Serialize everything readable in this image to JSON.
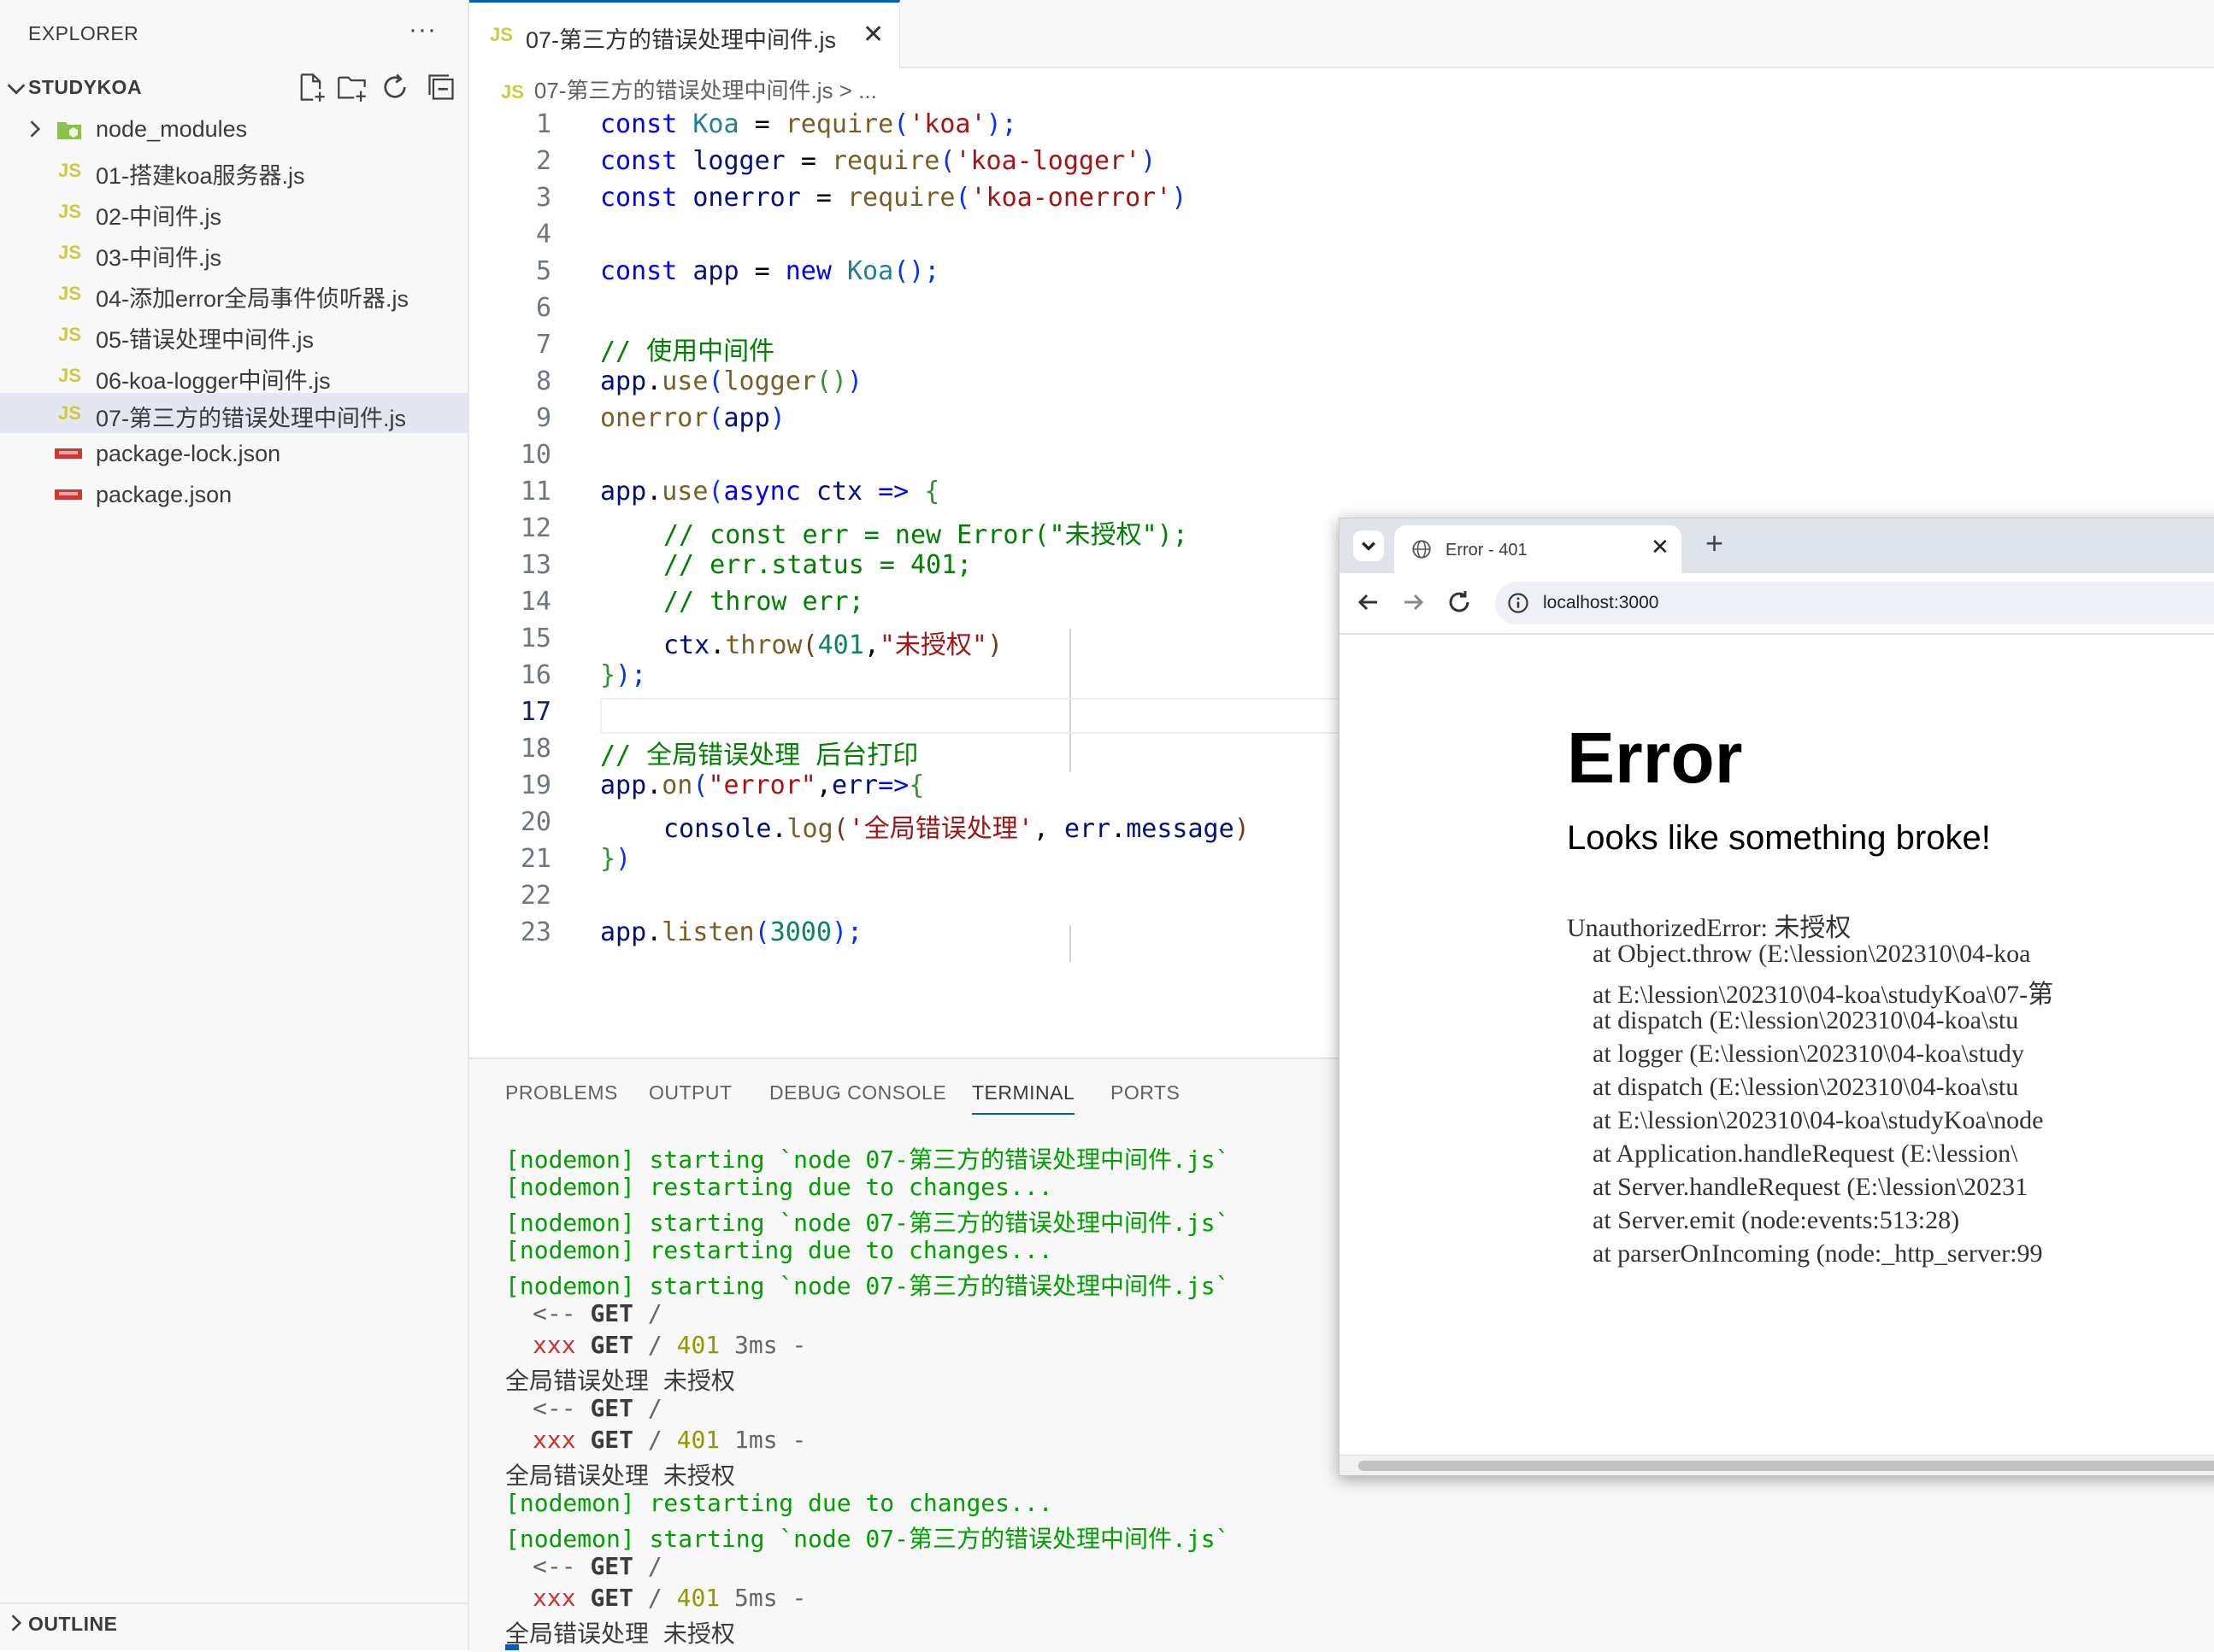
{
  "sidebar": {
    "header": "EXPLORER",
    "more": "···",
    "project": "STUDYKOA",
    "items": [
      {
        "label": "node_modules",
        "icon": "folder"
      },
      {
        "label": "01-搭建koa服务器.js",
        "icon": "js"
      },
      {
        "label": "02-中间件.js",
        "icon": "js"
      },
      {
        "label": "03-中间件.js",
        "icon": "js"
      },
      {
        "label": "04-添加error全局事件侦听器.js",
        "icon": "js"
      },
      {
        "label": "05-错误处理中间件.js",
        "icon": "js"
      },
      {
        "label": "06-koa-logger中间件.js",
        "icon": "js"
      },
      {
        "label": "07-第三方的错误处理中间件.js",
        "icon": "js",
        "active": true
      },
      {
        "label": "package-lock.json",
        "icon": "npm"
      },
      {
        "label": "package.json",
        "icon": "npm"
      }
    ],
    "outline": "OUTLINE"
  },
  "js_badge": "JS",
  "editor": {
    "tab_title": "07-第三方的错误处理中间件.js",
    "tab_close": "✕",
    "breadcrumb": "07-第三方的错误处理中间件.js > ...",
    "current_line": 17
  },
  "code_lines": [
    {
      "n": "1"
    },
    {
      "n": "2"
    },
    {
      "n": "3"
    },
    {
      "n": "4"
    },
    {
      "n": "5"
    },
    {
      "n": "6"
    },
    {
      "n": "7"
    },
    {
      "n": "8"
    },
    {
      "n": "9"
    },
    {
      "n": "10"
    },
    {
      "n": "11"
    },
    {
      "n": "12"
    },
    {
      "n": "13"
    },
    {
      "n": "14"
    },
    {
      "n": "15"
    },
    {
      "n": "16"
    },
    {
      "n": "17"
    },
    {
      "n": "18"
    },
    {
      "n": "19"
    },
    {
      "n": "20"
    },
    {
      "n": "21"
    },
    {
      "n": "22"
    },
    {
      "n": "23"
    }
  ],
  "code": {
    "l1": [
      "const",
      "Koa",
      "=",
      "require",
      "(",
      "'koa'",
      ");"
    ],
    "l2": [
      "const",
      "logger",
      "=",
      "require",
      "(",
      "'koa-logger'",
      ")"
    ],
    "l3": [
      "const",
      "onerror",
      "=",
      "require",
      "(",
      "'koa-onerror'",
      ")"
    ],
    "l5": [
      "const",
      "app",
      "=",
      "new",
      "Koa",
      "();"
    ],
    "l7": "// 使用中间件",
    "l8": [
      "app",
      ".",
      "use",
      "(",
      "logger",
      "()",
      ")"
    ],
    "l9": [
      "onerror",
      "(",
      "app",
      ")"
    ],
    "l11": [
      "app",
      ".",
      "use",
      "(",
      "async",
      "ctx",
      "=>",
      "{"
    ],
    "l12": "// const err = new Error(\"未授权\");",
    "l13": "// err.status = 401;",
    "l14": "// throw err;",
    "l15": [
      "ctx",
      ".",
      "throw",
      "(",
      "401",
      ",",
      "\"未授权\"",
      ")"
    ],
    "l16": [
      "}",
      ");"
    ],
    "l18": "// 全局错误处理 后台打印",
    "l19": [
      "app",
      ".",
      "on",
      "(",
      "\"error\"",
      ",",
      "err",
      "=>",
      "{"
    ],
    "l20": [
      "console",
      ".",
      "log",
      "(",
      "'全局错误处理'",
      ", ",
      "err",
      ".",
      "message",
      ")"
    ],
    "l21": [
      "}",
      ")"
    ],
    "l23": [
      "app",
      ".",
      "listen",
      "(",
      "3000",
      ");"
    ]
  },
  "panel": {
    "tabs": [
      "PROBLEMS",
      "OUTPUT",
      "DEBUG CONSOLE",
      "TERMINAL",
      "PORTS"
    ],
    "active_tab": "TERMINAL"
  },
  "terminal": {
    "nodemon_start": "[nodemon] starting `node 07-第三方的错误处理中间件.js`",
    "nodemon_restart": "[nodemon] restarting due to changes...",
    "req_in_arrow": "<--",
    "req_out_x": "xxx",
    "method": "GET",
    "path": "/",
    "status": "401",
    "dash": "-",
    "times": [
      "3ms",
      "1ms",
      "5ms"
    ],
    "log_msg": "全局错误处理 未授权"
  },
  "browser": {
    "tab_title": "Error - 401",
    "url": "localhost:3000",
    "error_title": "Error",
    "error_sub": "Looks like something broke!",
    "stack": [
      "UnauthorizedError: 未授权",
      "    at Object.throw (E:\\lession\\202310\\04-koa",
      "    at E:\\lession\\202310\\04-koa\\studyKoa\\07-第",
      "    at dispatch (E:\\lession\\202310\\04-koa\\stu",
      "    at logger (E:\\lession\\202310\\04-koa\\study",
      "    at dispatch (E:\\lession\\202310\\04-koa\\stu",
      "    at E:\\lession\\202310\\04-koa\\studyKoa\\node",
      "    at Application.handleRequest (E:\\lession\\",
      "    at Server.handleRequest (E:\\lession\\20231",
      "    at Server.emit (node:events:513:28)",
      "    at parserOnIncoming (node:_http_server:99"
    ]
  }
}
